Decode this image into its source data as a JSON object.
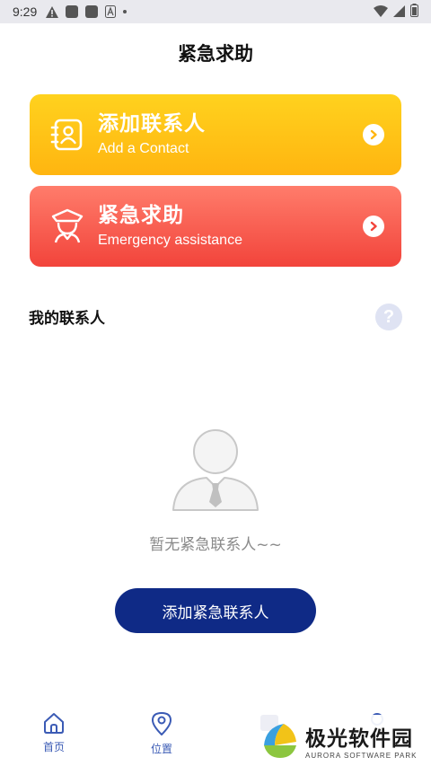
{
  "status_bar": {
    "time": "9:29",
    "icons": [
      "warning-icon",
      "app-notification-icon",
      "app-notification-icon",
      "text-icon",
      "dot-icon"
    ],
    "right_icons": [
      "wifi-icon",
      "signal-icon",
      "battery-icon"
    ]
  },
  "header": {
    "title": "紧急求助"
  },
  "cards": {
    "contact": {
      "title": "添加联系人",
      "subtitle": "Add a Contact",
      "icon": "contact-book-icon",
      "color": "#ffc414"
    },
    "emergency": {
      "title": "紧急求助",
      "subtitle": "Emergency assistance",
      "icon": "police-officer-icon",
      "color": "#f85a4c"
    }
  },
  "section": {
    "title": "我的联系人",
    "help_symbol": "?"
  },
  "empty_state": {
    "message": "暂无紧急联系人~~",
    "icon": "person-placeholder-icon"
  },
  "primary_button": {
    "label": "添加紧急联系人",
    "color": "#0f2a86"
  },
  "bottom_nav": {
    "items": [
      {
        "label": "首页",
        "icon": "home-icon"
      },
      {
        "label": "位置",
        "icon": "location-pin-icon"
      },
      {
        "label": "",
        "icon": "sos-icon"
      },
      {
        "label": "",
        "icon": "profile-icon"
      }
    ],
    "accent": "#3b5bb5"
  },
  "watermark": {
    "main": "极光软件园",
    "sub": "AURORA SOFTWARE PARK"
  }
}
